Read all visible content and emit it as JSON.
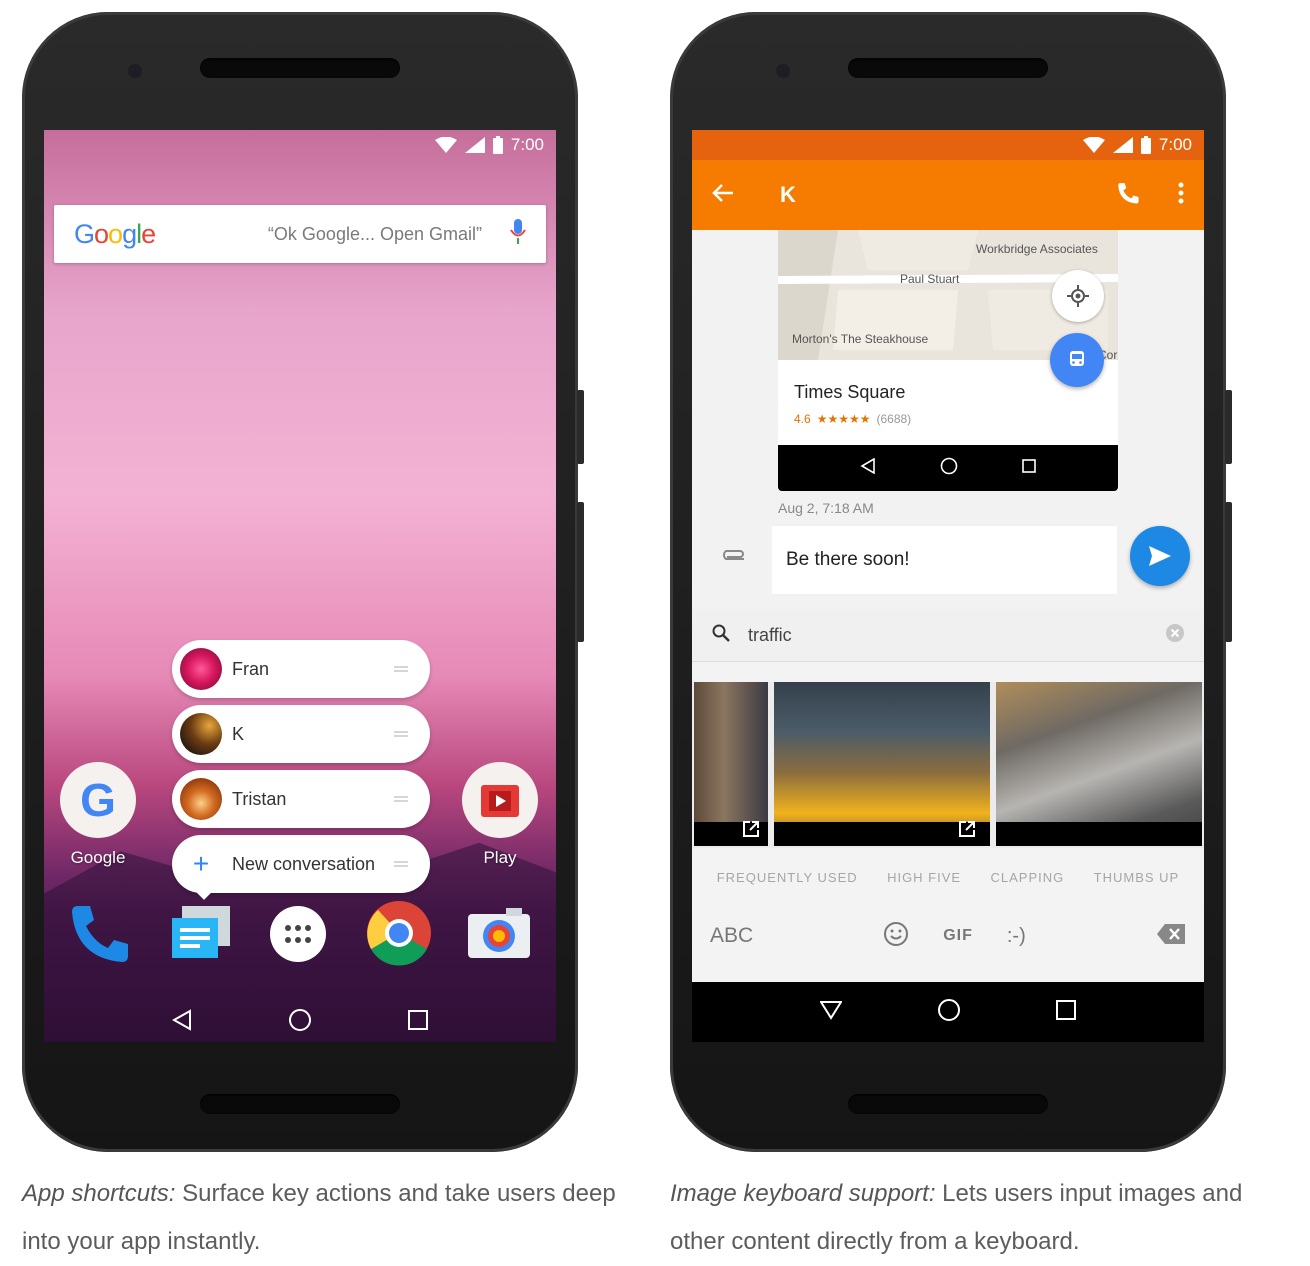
{
  "status": {
    "time": "7:00"
  },
  "left_phone": {
    "search": {
      "brand": "Google",
      "hint": "“Ok Google... Open Gmail”"
    },
    "shortcuts": [
      {
        "label": "Fran"
      },
      {
        "label": "K"
      },
      {
        "label": "Tristan"
      },
      {
        "label": "New conversation"
      }
    ],
    "apps": [
      {
        "label": "Google"
      },
      {
        "label": "Play"
      }
    ]
  },
  "right_phone": {
    "contact": "K",
    "map": {
      "labels": [
        "Workbridge Associates",
        "Paul Stuart",
        "Morton's The Steakhouse",
        "Cor"
      ],
      "place": "Times Square",
      "rating": "4.6",
      "stars": "★★★★★",
      "reviews": "(6688)"
    },
    "timestamp": "Aug 2, 7:18 AM",
    "message": "Be there soon!",
    "search_query": "traffic",
    "categories": [
      "FREQUENTLY USED",
      "HIGH FIVE",
      "CLAPPING",
      "THUMBS UP"
    ],
    "keyboard": {
      "abc": "ABC",
      "gif": "GIF",
      "emoticon": ":-)"
    }
  },
  "captions": {
    "left": {
      "lead": "App shortcuts:",
      "text": " Surface key actions and take users deep into your app instantly."
    },
    "right": {
      "lead": "Image keyboard support:",
      "text": " Lets users input images and other content directly from a keyboard."
    }
  },
  "colors": {
    "accent_orange": "#f57c00",
    "send_blue": "#1e88e5",
    "shortcut_plus": "#2f86f6"
  }
}
